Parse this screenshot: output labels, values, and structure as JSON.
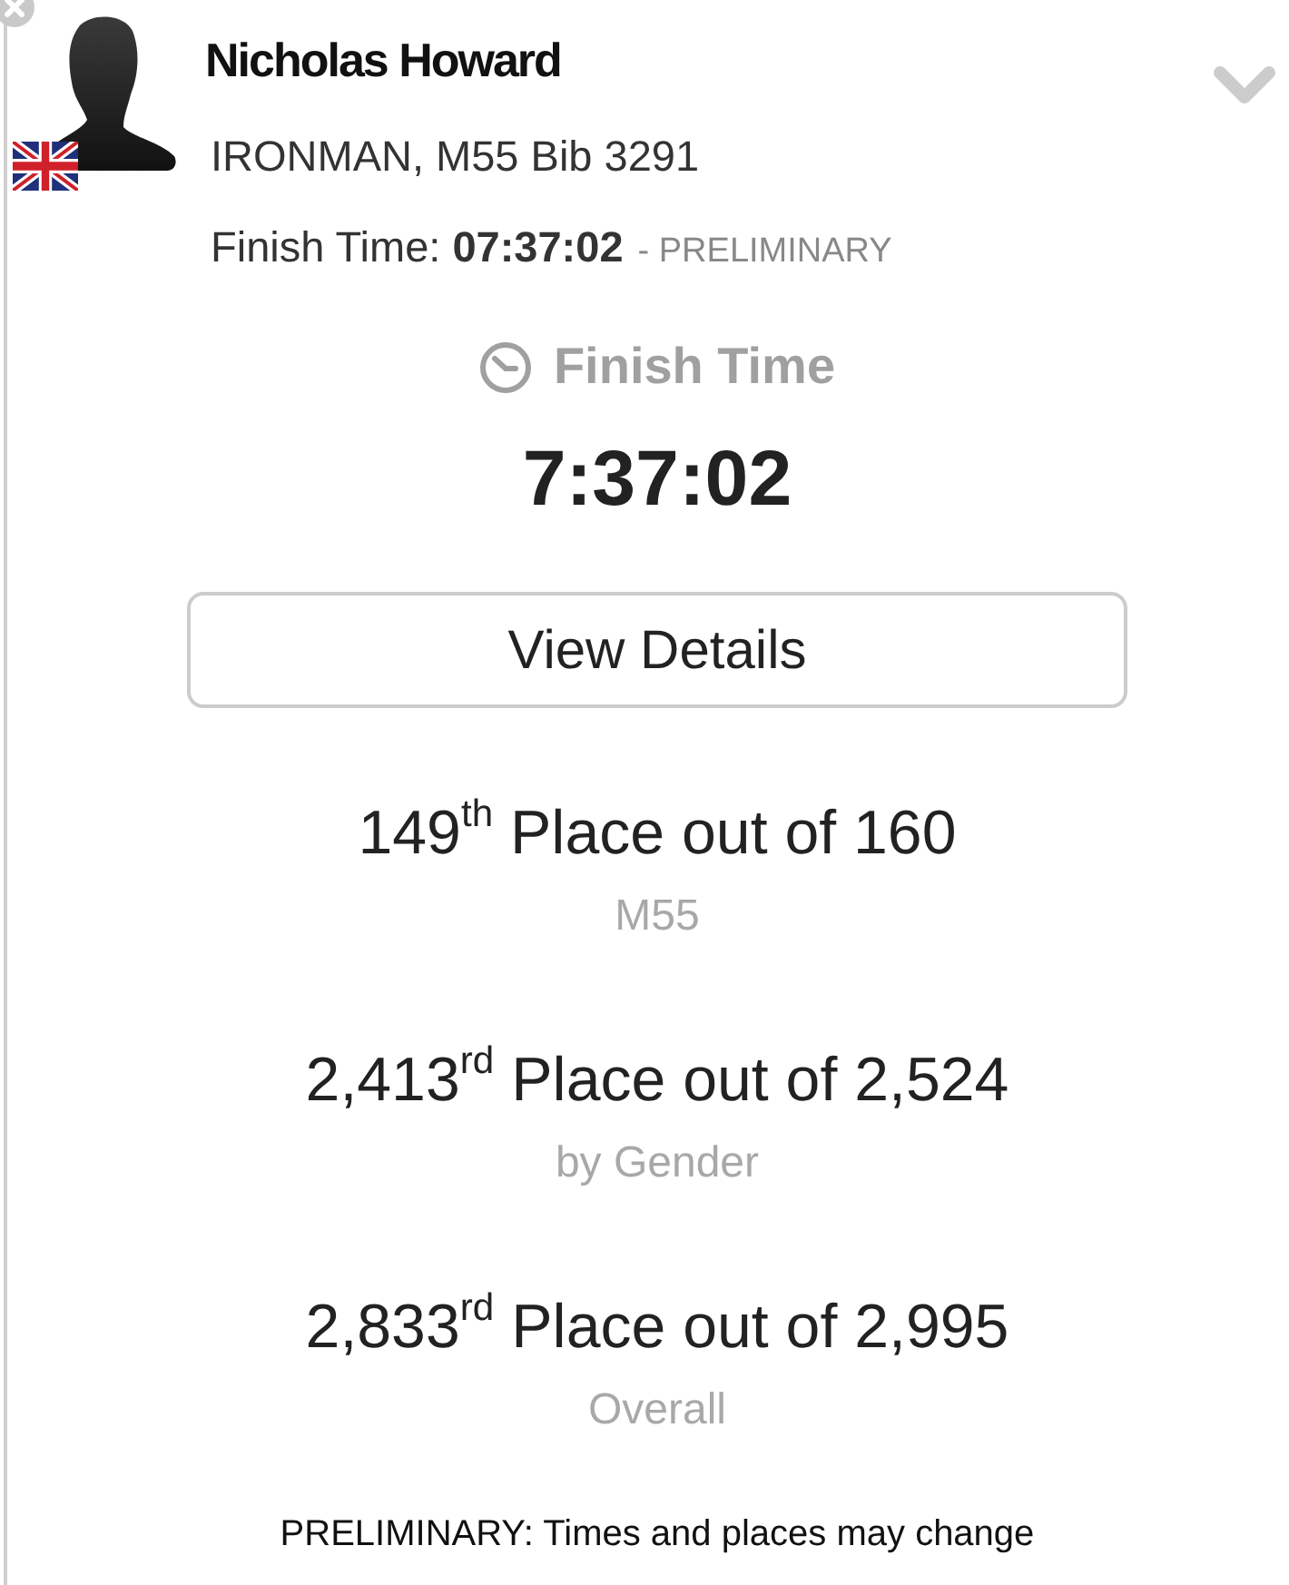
{
  "athlete": {
    "name": "Nicholas Howard",
    "division": "IRONMAN, M55 Bib 3291",
    "finish_line": "Finish Time: **07:37:02**",
    "status": "- PRELIMINARY"
  },
  "finish_time": {
    "label": "Finish Time",
    "value": "7:37:02"
  },
  "details_button": {
    "label": "View Details"
  },
  "placements": [
    {
      "rank": "149$^{th}$ Place out of 160",
      "category": "M55"
    },
    {
      "rank": "2,413$^{rd}$ Place out of 2,524",
      "category": "by Gender"
    },
    {
      "rank": "2,833$^{rd}$ Place out of 2,995",
      "category": "Overall"
    }
  ],
  "footer_note": "PRELIMINARY: Times and places may change"
}
